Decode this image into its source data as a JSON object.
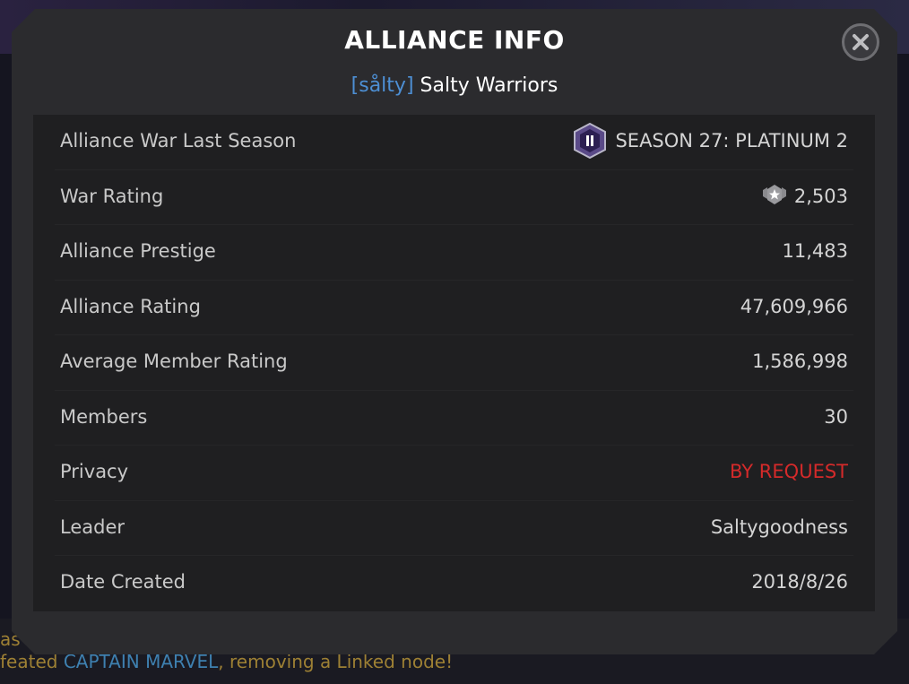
{
  "modal": {
    "title": "ALLIANCE INFO",
    "tag": "[sålty]",
    "name": "Salty Warriors"
  },
  "rows": [
    {
      "label": "Alliance War Last Season",
      "value": "SEASON 27: PLATINUM 2",
      "icon": "platinum-2-badge-icon"
    },
    {
      "label": "War Rating",
      "value": "2,503",
      "icon": "war-rating-star-icon"
    },
    {
      "label": "Alliance Prestige",
      "value": "11,483"
    },
    {
      "label": "Alliance Rating",
      "value": "47,609,966"
    },
    {
      "label": "Average Member Rating",
      "value": "1,586,998"
    },
    {
      "label": "Members",
      "value": "30"
    },
    {
      "label": "Privacy",
      "value": "BY REQUEST",
      "color": "#d42a2a"
    },
    {
      "label": "Leader",
      "value": "Saltygoodness"
    },
    {
      "label": "Date Created",
      "value": "2018/8/26"
    }
  ],
  "background": {
    "feed_left": "as",
    "feed_prefix": "feated ",
    "feed_hero": "CAPTAIN MARVEL",
    "feed_suffix": ", removing a Linked node!"
  },
  "colors": {
    "tag": "#4d8fd4",
    "privacy": "#d42a2a",
    "hero": "#4aa3e0"
  }
}
